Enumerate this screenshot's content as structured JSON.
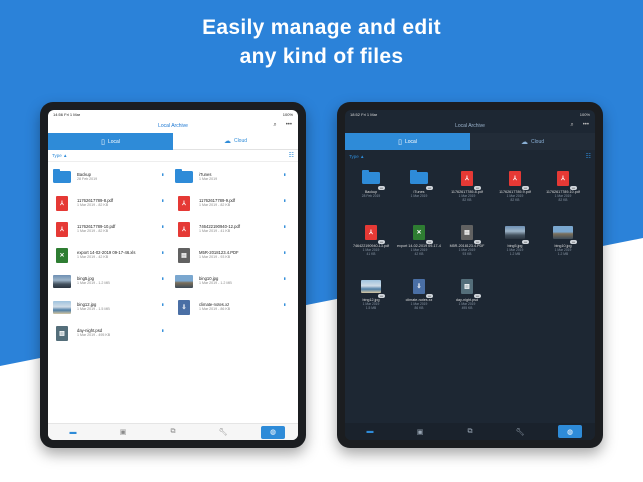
{
  "headline": {
    "line1": "Easily manage and edit",
    "line2": "any kind of files"
  },
  "colors": {
    "accent": "#2e8bd8",
    "hero_bg": "#2b82d9",
    "dark_screen": "#1d2733"
  },
  "light": {
    "status": {
      "time": "14:56  Fri 1 Mar",
      "battery": "100%"
    },
    "title": "Local Archive",
    "tabs": {
      "local": "Local",
      "cloud": "Cloud"
    },
    "sort_label": "Type ▲",
    "files": [
      {
        "name": "Backup",
        "details": "28 Feb 2019",
        "icon": "folder-icon"
      },
      {
        "name": "iTunes",
        "details": "1 Mar 2019",
        "icon": "usb-folder-icon"
      },
      {
        "name": "11762617789-8.pdf",
        "details": "1 Mar 2019 - 82 KB",
        "icon": "pdf-icon"
      },
      {
        "name": "11762617789-9.pdf",
        "details": "1 Mar 2019 - 82 KB",
        "icon": "pdf-icon"
      },
      {
        "name": "11762617789-10.pdf",
        "details": "1 Mar 2019 - 82 KB",
        "icon": "pdf-icon"
      },
      {
        "name": "746422190940-12.pdf",
        "details": "1 Mar 2019 - 41 KB",
        "icon": "pdf-icon"
      },
      {
        "name": "export 14-02-2019 09-17-46.xls",
        "details": "1 Mar 2019 - 42 KB",
        "icon": "xls-icon"
      },
      {
        "name": "M5R-2018123.4.PDF",
        "details": "1 Mar 2019 - 93 KB",
        "icon": "zip-icon"
      },
      {
        "name": "bing5.jpg",
        "details": "1 Mar 2019 - 1.2 MB",
        "icon": "image-icon"
      },
      {
        "name": "bing10.jpg",
        "details": "1 Mar 2019 - 1.2 MB",
        "icon": "image-icon"
      },
      {
        "name": "bing12.jpg",
        "details": "1 Mar 2019 - 1.5 MB",
        "icon": "image-icon"
      },
      {
        "name": "climate-notes.xz",
        "details": "1 Mar 2019 - 86 KB",
        "icon": "archive-icon"
      },
      {
        "name": "day-night.psd",
        "details": "1 Mar 2019 - 495 KB",
        "icon": "psd-icon"
      }
    ]
  },
  "dark": {
    "status": {
      "time": "18:52  Fri 1 Mar",
      "battery": "100%"
    },
    "title": "Local Archive",
    "tabs": {
      "local": "Local",
      "cloud": "Cloud"
    },
    "sort_label": "Type ▲",
    "files": [
      {
        "name": "Backup",
        "details": "28 Feb 2019",
        "icon": "folder-icon"
      },
      {
        "name": "iTunes",
        "details": "1 Mar 2019",
        "icon": "usb-folder-icon"
      },
      {
        "name": "11762617789-8.pdf",
        "details": "1 Mar 2019\n82 KB",
        "icon": "pdf-icon"
      },
      {
        "name": "11762617789-9.pdf",
        "details": "1 Mar 2019\n82 KB",
        "icon": "pdf-icon"
      },
      {
        "name": "11762617789-10.pdf",
        "details": "1 Mar 2019\n82 KB",
        "icon": "pdf-icon"
      },
      {
        "name": "746422190940-13.pdf",
        "details": "1 Mar 2019\n41 KB",
        "icon": "pdf-icon"
      },
      {
        "name": "export 14-02-2019 09-17-46.xls",
        "details": "1 Mar 2019\n42 KB",
        "icon": "xls-icon"
      },
      {
        "name": "M5R-2018123.4.PDF",
        "details": "1 Mar 2019\n93 KB",
        "icon": "zip-icon"
      },
      {
        "name": "bing5.jpg",
        "details": "1 Mar 2019\n1.2 MB",
        "icon": "image-icon"
      },
      {
        "name": "bing10.jpg",
        "details": "1 Mar 2019\n1.2 MB",
        "icon": "image-icon"
      },
      {
        "name": "bing12.jpg",
        "details": "1 Mar 2019\n1.5 MB",
        "icon": "image-icon"
      },
      {
        "name": "climate-notes.xz",
        "details": "1 Mar 2019\n86 KB",
        "icon": "archive-icon"
      },
      {
        "name": "day-night.psd",
        "details": "1 Mar 2019\n495 KB",
        "icon": "psd-icon"
      }
    ]
  },
  "bottom_tabs": [
    "folder-icon",
    "image-icon",
    "network-icon",
    "wrench-icon",
    "globe-icon"
  ]
}
